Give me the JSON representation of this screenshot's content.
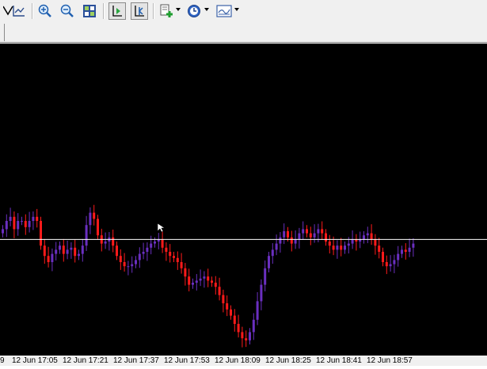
{
  "toolbar": {
    "icons": [
      "line-studies-icon",
      "period-separators-icon",
      "zoom-in-icon",
      "zoom-out-icon",
      "tile-windows-icon",
      "chart-shift-icon",
      "autoscroll-icon",
      "new-order-icon",
      "periodicity-icon",
      "templates-icon"
    ]
  },
  "chart_data": {
    "type": "candlestick",
    "bullish_color": "#6a2fc0",
    "bearish_color": "#ff1a1a",
    "background": "#000000",
    "price_line_color": "#ffffff",
    "price_line_level": 0.51,
    "grid": false,
    "x_tick_labels": [
      "9",
      "12 Jun 17:05",
      "12 Jun 17:21",
      "12 Jun 17:37",
      "12 Jun 17:53",
      "12 Jun 18:09",
      "12 Jun 18:25",
      "12 Jun 18:41",
      "12 Jun 18:57"
    ],
    "close": [
      0.56,
      0.6,
      0.62,
      0.56,
      0.6,
      0.6,
      0.57,
      0.6,
      0.62,
      0.6,
      0.48,
      0.43,
      0.4,
      0.44,
      0.46,
      0.48,
      0.44,
      0.46,
      0.47,
      0.43,
      0.44,
      0.48,
      0.58,
      0.64,
      0.61,
      0.53,
      0.49,
      0.5,
      0.52,
      0.48,
      0.43,
      0.4,
      0.38,
      0.38,
      0.39,
      0.41,
      0.44,
      0.45,
      0.47,
      0.49,
      0.5,
      0.51,
      0.47,
      0.45,
      0.43,
      0.42,
      0.4,
      0.37,
      0.33,
      0.29,
      0.3,
      0.31,
      0.32,
      0.33,
      0.31,
      0.3,
      0.28,
      0.24,
      0.2,
      0.17,
      0.14,
      0.1,
      0.06,
      0.03,
      0.02,
      0.06,
      0.12,
      0.21,
      0.29,
      0.37,
      0.43,
      0.46,
      0.49,
      0.52,
      0.55,
      0.52,
      0.49,
      0.51,
      0.54,
      0.56,
      0.54,
      0.52,
      0.54,
      0.56,
      0.54,
      0.5,
      0.48,
      0.46,
      0.48,
      0.46,
      0.48,
      0.49,
      0.51,
      0.5,
      0.51,
      0.53,
      0.54,
      0.51,
      0.48,
      0.45,
      0.4,
      0.38,
      0.39,
      0.41,
      0.44,
      0.46,
      0.45,
      0.47,
      0.49
    ]
  }
}
